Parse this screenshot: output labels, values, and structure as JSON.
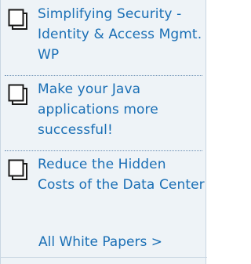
{
  "white_papers": {
    "items": [
      {
        "icon": "document-icon",
        "title": "Simplifying Security - Identity & Access Mgmt. WP"
      },
      {
        "icon": "document-icon",
        "title": "Make your Java applications more successful!"
      },
      {
        "icon": "document-icon",
        "title": "Reduce the Hidden Costs of the Data Center"
      }
    ],
    "all_link": "All White Papers >"
  },
  "colors": {
    "link": "#1a6fb5",
    "panel_bg": "#eef3f7",
    "icon_stroke": "#1a1a1a"
  }
}
